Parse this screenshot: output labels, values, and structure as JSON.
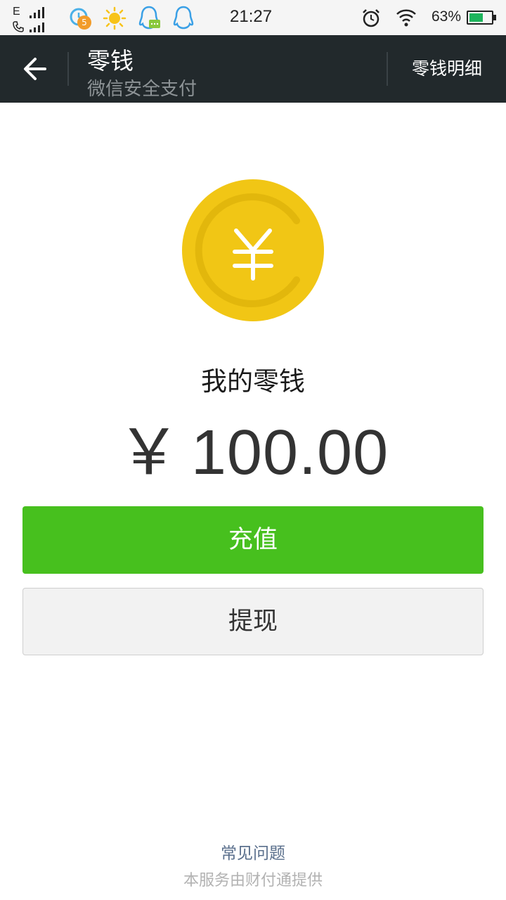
{
  "status_bar": {
    "network": "E",
    "notification_badge": "5",
    "time": "21:27",
    "battery_percent": "63%",
    "battery_level": 0.63,
    "icons": [
      "signal-icon",
      "phone-icon",
      "sync-notification-icon",
      "weather-sun-icon",
      "qq-message-icon",
      "qq-icon",
      "alarm-icon",
      "wifi-icon",
      "battery-icon"
    ]
  },
  "nav": {
    "title": "零钱",
    "subtitle": "微信安全支付",
    "detail_link": "零钱明细",
    "back_icon": "back-arrow-icon"
  },
  "wallet": {
    "label": "我的零钱",
    "currency_symbol": "￥",
    "amount": "100.00",
    "coin_icon": "yuan-coin-icon",
    "coin_color": "#f1c615"
  },
  "actions": {
    "recharge": "充值",
    "withdraw": "提现",
    "primary_color": "#47c01e"
  },
  "footer": {
    "faq": "常见问题",
    "provider": "本服务由财付通提供"
  }
}
